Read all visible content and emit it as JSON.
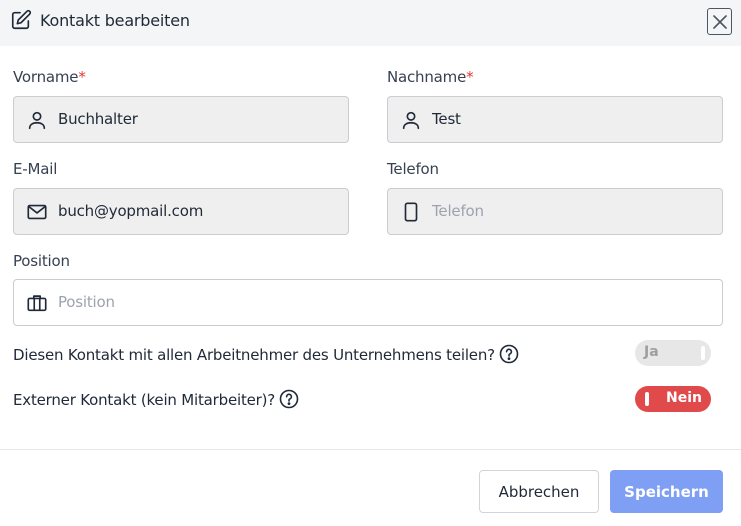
{
  "header": {
    "title": "Kontakt bearbeiten",
    "edit_icon": "edit-icon",
    "close_icon": "close-icon"
  },
  "fields": {
    "vorname": {
      "label": "Vorname",
      "required_mark": "*",
      "value": "Buchhalter",
      "icon": "user-icon"
    },
    "nachname": {
      "label": "Nachname",
      "required_mark": "*",
      "value": "Test",
      "icon": "user-icon"
    },
    "email": {
      "label": "E-Mail",
      "value": "buch@yopmail.com",
      "icon": "mail-icon"
    },
    "telefon": {
      "label": "Telefon",
      "placeholder": "Telefon",
      "value": "",
      "icon": "phone-icon"
    },
    "position": {
      "label": "Position",
      "placeholder": "Position",
      "value": "",
      "icon": "briefcase-icon"
    }
  },
  "questions": {
    "share": {
      "text": "Diesen Kontakt mit allen Arbeitnehmer des Unternehmens teilen?",
      "toggle_label": "Ja",
      "toggle_on": false
    },
    "external": {
      "text": "Externer Kontakt (kein Mitarbeiter)?",
      "toggle_label": "Nein",
      "toggle_on": true
    }
  },
  "footer": {
    "cancel_label": "Abbrechen",
    "save_label": "Speichern"
  },
  "colors": {
    "accent": "#7f9ff5",
    "toggle_on": "#e04a4a",
    "required": "#e53935"
  }
}
